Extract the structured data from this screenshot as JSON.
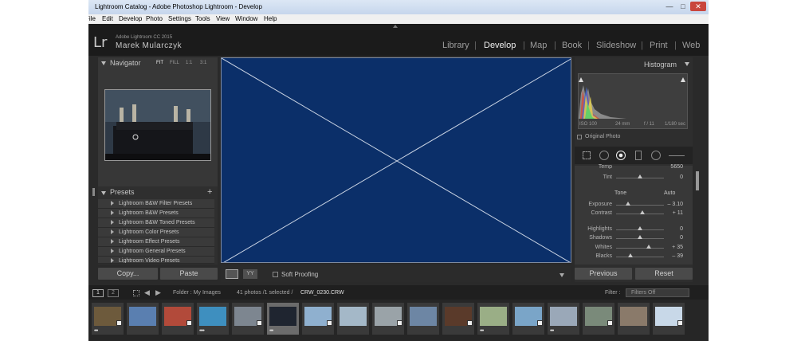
{
  "window": {
    "title": "Lightroom Catalog - Adobe Photoshop Lightroom - Develop",
    "minimize": "—",
    "maximize": "□",
    "close": "✕"
  },
  "menu": [
    "File",
    "Edit",
    "Develop",
    "Photo",
    "Settings",
    "Tools",
    "View",
    "Window",
    "Help"
  ],
  "identity": {
    "logo": "Lr",
    "product": "Adobe Lightroom CC 2015",
    "user": "Marek Mularczyk"
  },
  "modules": {
    "items": [
      "Library",
      "Develop",
      "Map",
      "Book",
      "Slideshow",
      "Print",
      "Web"
    ],
    "separator": "|",
    "active": "Develop"
  },
  "navigator": {
    "title": "Navigator",
    "zoom_options": [
      "FIT",
      "FILL",
      "1:1",
      "3:1"
    ],
    "zoom_selected": "FIT"
  },
  "presets": {
    "title": "Presets",
    "add": "+",
    "items": [
      "Lightroom B&W Filter Presets",
      "Lightroom B&W Presets",
      "Lightroom B&W Toned Presets",
      "Lightroom Color Presets",
      "Lightroom Effect Presets",
      "Lightroom General Presets",
      "Lightroom Video Presets"
    ]
  },
  "left_buttons": {
    "copy": "Copy...",
    "paste": "Paste"
  },
  "toolbar": {
    "soft_proofing": "Soft Proofing"
  },
  "histogram": {
    "title": "Histogram",
    "iso": "ISO 100",
    "focal": "24 mm",
    "aperture": "f / 11",
    "shutter": "1/180 sec",
    "original_photo": "Original Photo"
  },
  "basic": {
    "temp_label": "Temp",
    "temp_value": "5650",
    "tint_label": "Tint",
    "tint_value": "0",
    "tone_label": "Tone",
    "auto_label": "Auto",
    "sliders": [
      {
        "label": "Exposure",
        "value": "– 3.10",
        "level": 0.25
      },
      {
        "label": "Contrast",
        "value": "+ 11",
        "level": 0.55
      },
      {
        "label": "Highlights",
        "value": "0",
        "level": 0.5
      },
      {
        "label": "Shadows",
        "value": "0",
        "level": 0.5
      },
      {
        "label": "Whites",
        "value": "+ 35",
        "level": 0.68
      },
      {
        "label": "Blacks",
        "value": "– 39",
        "level": 0.3
      }
    ]
  },
  "right_buttons": {
    "previous": "Previous",
    "reset": "Reset"
  },
  "filmstrip": {
    "page1": "1",
    "page2": "2",
    "folder": "Folder : My Images",
    "count": "41 photos /1 selected /",
    "filename": "CRW_0230.CRW",
    "filter_label": "Filter :",
    "filter_value": "Filters Off",
    "thumbnails": [
      {
        "dots": "•••",
        "color": "#6d5a3c",
        "selected": false
      },
      {
        "dots": "",
        "color": "#5a7fb0",
        "selected": false
      },
      {
        "dots": "",
        "color": "#b24a3a",
        "selected": false
      },
      {
        "dots": "••••",
        "color": "#3e8fbf",
        "selected": false
      },
      {
        "dots": "",
        "color": "#7d8690",
        "selected": false
      },
      {
        "dots": "•••",
        "color": "#1f2530",
        "selected": true
      },
      {
        "dots": "",
        "color": "#8fb0cf",
        "selected": false
      },
      {
        "dots": "",
        "color": "#a4b8c8",
        "selected": false
      },
      {
        "dots": "",
        "color": "#9aa3a8",
        "selected": false
      },
      {
        "dots": "",
        "color": "#6d86a4",
        "selected": false
      },
      {
        "dots": "",
        "color": "#5a3a2a",
        "selected": false
      },
      {
        "dots": "•••",
        "color": "#9aae86",
        "selected": false
      },
      {
        "dots": "",
        "color": "#7aa5c8",
        "selected": false
      },
      {
        "dots": "•••",
        "color": "#9aa8b8",
        "selected": false
      },
      {
        "dots": "",
        "color": "#7a8a7a",
        "selected": false
      },
      {
        "dots": "",
        "color": "#8a7a6a",
        "selected": false
      },
      {
        "dots": "",
        "color": "#c8d8e8",
        "selected": false
      }
    ]
  }
}
